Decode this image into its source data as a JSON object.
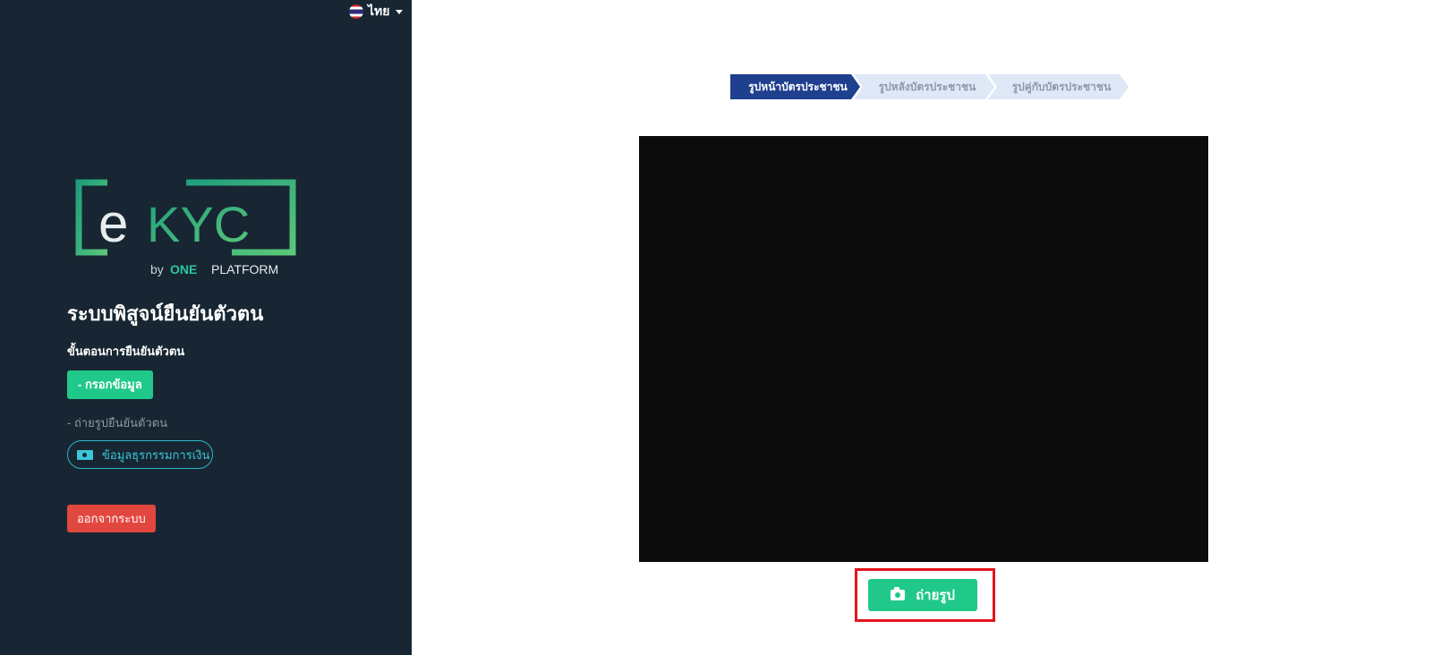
{
  "language": {
    "label": "ไทย",
    "flag_icon": "thai-flag-icon"
  },
  "logo": {
    "brand_e": "e",
    "brand_kyc": "KYC",
    "by_label": "by",
    "one_label": "ONE",
    "platform_label": "PLATFORM"
  },
  "sidebar": {
    "system_title": "ระบบพิสูจน์ยืนยันตัวตน",
    "steps_title": "ขั้นตอนการยืนยันตัวตน",
    "step_active": "- กรอกข้อมูล",
    "step_next": "- ถ่ายรูปยืนยันตัวตน",
    "finance_button": "ข้อมูลธุรกรรมการเงิน",
    "logout_button": "ออกจากระบบ"
  },
  "stepper": {
    "steps": [
      {
        "label": "รูปหน้าบัตรประชาชน",
        "active": true
      },
      {
        "label": "รูปหลังบัตรประชาชน",
        "active": false
      },
      {
        "label": "รูปคู่กับบัตรประชาชน",
        "active": false
      }
    ]
  },
  "capture": {
    "button_label": "ถ่ายรูป",
    "icon": "camera-icon"
  },
  "colors": {
    "sidebar_bg": "#172632",
    "accent_green": "#20c98a",
    "danger": "#e2473f",
    "stepper_active": "#1f3f8f",
    "stepper_inactive": "#dfe8f7",
    "highlight": "#e5141c"
  }
}
